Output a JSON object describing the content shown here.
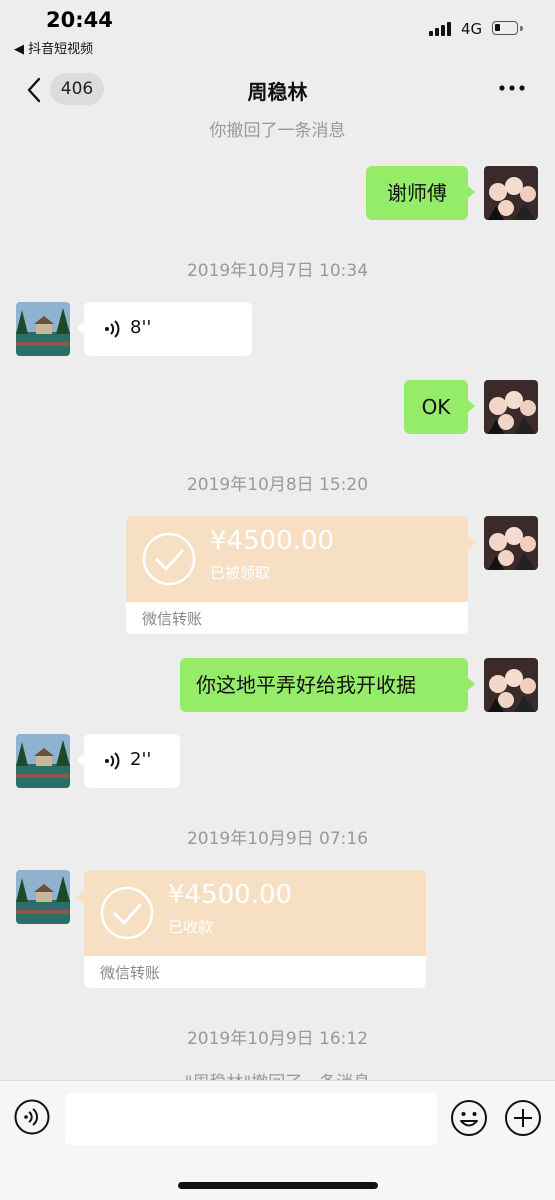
{
  "status_bar": {
    "time": "20:44",
    "back_app": "◀ 抖音短视频",
    "network": "4G",
    "battery_level": 0.25
  },
  "header": {
    "unread_count": "406",
    "title": "周稳林"
  },
  "messages": {
    "recall_top": "你撤回了一条消息",
    "m1_text": "谢师傅",
    "ts1": "2019年10月7日 10:34",
    "voice1": "8''",
    "m2_text": "OK",
    "ts2": "2019年10月8日 15:20",
    "transfer1": {
      "amount": "¥4500.00",
      "status": "已被领取",
      "label": "微信转账"
    },
    "m3_text": "你这地平弄好给我开收据",
    "voice2": "2''",
    "ts3": "2019年10月9日 07:16",
    "transfer2": {
      "amount": "¥4500.00",
      "status": "已收款",
      "label": "微信转账"
    },
    "ts4": "2019年10月9日 16:12",
    "recall_bottom": "\"周稳林\"撤回了一条消息"
  },
  "colors": {
    "sent_bubble": "#95ec69",
    "transfer_bg": "#f7dfc3",
    "chat_bg": "#ededed"
  },
  "icons": [
    "back-icon",
    "more-icon",
    "voice-icon",
    "check-icon",
    "emoji-icon",
    "plus-icon"
  ]
}
